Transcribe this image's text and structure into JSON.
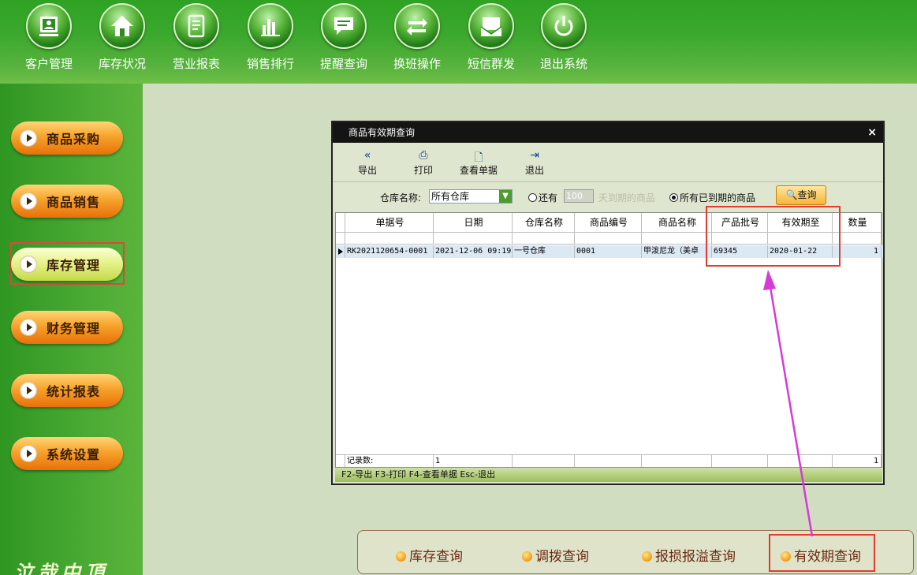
{
  "toolbar": {
    "items": [
      {
        "label": "客户管理",
        "icon": "customer-icon"
      },
      {
        "label": "库存状况",
        "icon": "home-icon"
      },
      {
        "label": "营业报表",
        "icon": "report-icon"
      },
      {
        "label": "销售排行",
        "icon": "bar-chart-icon"
      },
      {
        "label": "提醒查询",
        "icon": "message-icon"
      },
      {
        "label": "换班操作",
        "icon": "swap-icon"
      },
      {
        "label": "短信群发",
        "icon": "sms-icon"
      },
      {
        "label": "退出系统",
        "icon": "power-icon"
      }
    ]
  },
  "sidebar": {
    "items": [
      {
        "label": "商品采购",
        "active": false
      },
      {
        "label": "商品销售",
        "active": false
      },
      {
        "label": "库存管理",
        "active": true
      },
      {
        "label": "财务管理",
        "active": false
      },
      {
        "label": "统计报表",
        "active": false
      },
      {
        "label": "系统设置",
        "active": false
      }
    ],
    "logo_text": "泣哉中頂"
  },
  "dialog": {
    "title": "商品有效期查询",
    "close": "×",
    "tools": {
      "export": "导出",
      "print": "打印",
      "view": "查看单据",
      "exit": "退出"
    },
    "filter": {
      "warehouse_label": "仓库名称:",
      "warehouse_value": "所有仓库",
      "radio1_label": "还有",
      "days_value": "100",
      "radio1_suffix": "天到期的商品",
      "radio2_label": "所有已到期的商品",
      "query": "查询"
    },
    "table": {
      "headers": [
        "单据号",
        "日期",
        "仓库名称",
        "商品编号",
        "商品名称",
        "产品批号",
        "有效期至",
        "数量"
      ],
      "rows": [
        [
          "RK2021120654-0001",
          "2021-12-06 09:19",
          "一号仓库",
          "0001",
          "甲泼尼龙（美卓",
          "69345",
          "2020-01-22",
          "1"
        ]
      ],
      "footer": {
        "label": "记录数:",
        "count": "1",
        "total": "1"
      }
    },
    "status": "F2-导出 F3-打印 F4-查看单据 Esc-退出"
  },
  "submenu": {
    "items": [
      "库存查询",
      "调拨查询",
      "报损报溢查询",
      "有效期查询"
    ]
  },
  "colors": {
    "highlight": "#e23b30",
    "arrow": "#d63ad8",
    "brand_green": "#3aa82c"
  }
}
